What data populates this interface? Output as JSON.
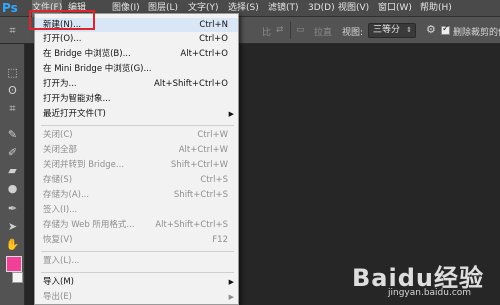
{
  "app": {
    "logo": "Ps"
  },
  "menubar": {
    "items": [
      "文件(F)",
      "编辑",
      "图像(I)",
      "图层(L)",
      "文字(Y)",
      "选择(S)",
      "滤镜(T)",
      "3D(D)",
      "视图(V)",
      "窗口(W)",
      "帮助(H)"
    ],
    "active_index": 0
  },
  "options": {
    "ratio_unit": "比",
    "swap_label": "拉直",
    "view_label": "视图:",
    "view_value": "三等分",
    "delete_crop_label": "删除裁剪的像素",
    "delete_crop_checked": true
  },
  "file_menu": {
    "items": [
      {
        "label": "新建(N)...",
        "shortcut": "Ctrl+N",
        "enabled": true,
        "highlighted": true
      },
      {
        "label": "打开(O)...",
        "shortcut": "Ctrl+O",
        "enabled": true
      },
      {
        "label": "在 Bridge 中浏览(B)...",
        "shortcut": "Alt+Ctrl+O",
        "enabled": true
      },
      {
        "label": "在 Mini Bridge 中浏览(G)...",
        "shortcut": "",
        "enabled": true
      },
      {
        "label": "打开为...",
        "shortcut": "Alt+Shift+Ctrl+O",
        "enabled": true
      },
      {
        "label": "打开为智能对象...",
        "shortcut": "",
        "enabled": true
      },
      {
        "label": "最近打开文件(T)",
        "shortcut": "",
        "enabled": true,
        "submenu": true
      },
      {
        "label": "关闭(C)",
        "shortcut": "Ctrl+W",
        "enabled": false
      },
      {
        "label": "关闭全部",
        "shortcut": "Alt+Ctrl+W",
        "enabled": false
      },
      {
        "label": "关闭并转到 Bridge...",
        "shortcut": "Shift+Ctrl+W",
        "enabled": false
      },
      {
        "label": "存储(S)",
        "shortcut": "Ctrl+S",
        "enabled": false
      },
      {
        "label": "存储为(A)...",
        "shortcut": "Shift+Ctrl+S",
        "enabled": false
      },
      {
        "label": "签入(I)...",
        "shortcut": "",
        "enabled": false
      },
      {
        "label": "存储为 Web 所用格式...",
        "shortcut": "Alt+Shift+Ctrl+S",
        "enabled": false
      },
      {
        "label": "恢复(V)",
        "shortcut": "F12",
        "enabled": false
      },
      {
        "label": "置入(L)...",
        "shortcut": "",
        "enabled": false
      },
      {
        "label": "导入(M)",
        "shortcut": "",
        "enabled": true,
        "submenu": true
      },
      {
        "label": "导出(E)",
        "shortcut": "",
        "enabled": false,
        "submenu": true
      }
    ]
  },
  "colors": {
    "foreground": "#f04098",
    "background": "#f4f4f4",
    "highlight_box": "#e0242b"
  },
  "watermark": {
    "brand": "Baidu经验",
    "url": "jingyan.baidu.com"
  }
}
